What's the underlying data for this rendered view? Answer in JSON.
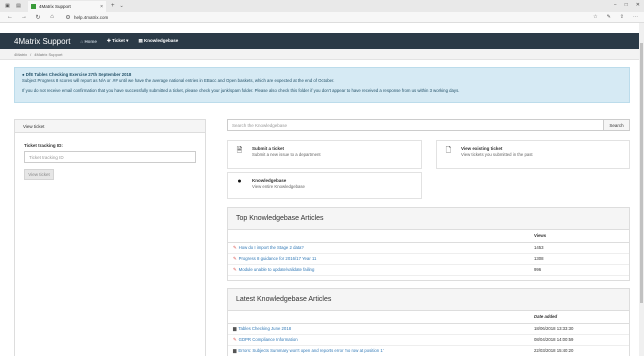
{
  "browser": {
    "tab_title": "4Matrix Support",
    "url": "help.4matrix.com"
  },
  "navbar": {
    "brand": "4Matrix Support",
    "items": [
      {
        "label": "Home",
        "icon": "home-icon"
      },
      {
        "label": "Ticket",
        "icon": "ticket-icon"
      },
      {
        "label": "Knowledgebase",
        "icon": "book-icon"
      }
    ]
  },
  "breadcrumb": [
    "4Matrix",
    "4Matrix Support"
  ],
  "alert": {
    "line1": "DfE Tables Checking Exercise  27th September 2018",
    "line2": "Subject Progress 8 scores will report as N/A or .## until we have the average national entries in EBacc and Open baskets, which are expected at the end of October.",
    "line3": "If you do not receive email confirmation that you have successfully submitted a ticket, please check your junk/spam folder. Please also check this folder if you don't appear to have received a response from us within 3 working days."
  },
  "view_ticket": {
    "header": "View ticket",
    "label": "Ticket tracking ID:",
    "placeholder": "Ticket tracking ID",
    "button": "View ticket"
  },
  "search": {
    "placeholder": "Search the Knowledgebase",
    "button": "Search"
  },
  "actions": [
    {
      "title": "Submit a ticket",
      "desc": "Submit a new issue to a department",
      "icon": "plus-document-icon"
    },
    {
      "title": "View existing ticket",
      "desc": "View tickets you submitted in the past",
      "icon": "document-icon"
    },
    {
      "title": "Knowledgebase",
      "desc": "View entire Knowledgebase",
      "icon": "lightbulb-icon"
    }
  ],
  "top_articles": {
    "title": "Top Knowledgebase Articles",
    "col_views": "Views",
    "rows": [
      {
        "title": "How do I import the Stage 2 data?",
        "views": "1453"
      },
      {
        "title": "Progress 8 guidance for 2016/17 Year 11",
        "views": "1308"
      },
      {
        "title": "Module unable to update/validate failing",
        "views": "996"
      }
    ]
  },
  "latest_articles": {
    "title": "Latest Knowledgebase Articles",
    "col_date": "Date added",
    "rows": [
      {
        "title": "Tables Checking June 2018",
        "date": "18/06/2018 13:33:30"
      },
      {
        "title": "GDPR Compliance Information",
        "date": "08/04/2018 14:00:59"
      },
      {
        "title": "Errors: Subjects Summary won't open and reports error 'no row at position 1'",
        "date": "22/03/2018 15:40:20"
      }
    ]
  }
}
